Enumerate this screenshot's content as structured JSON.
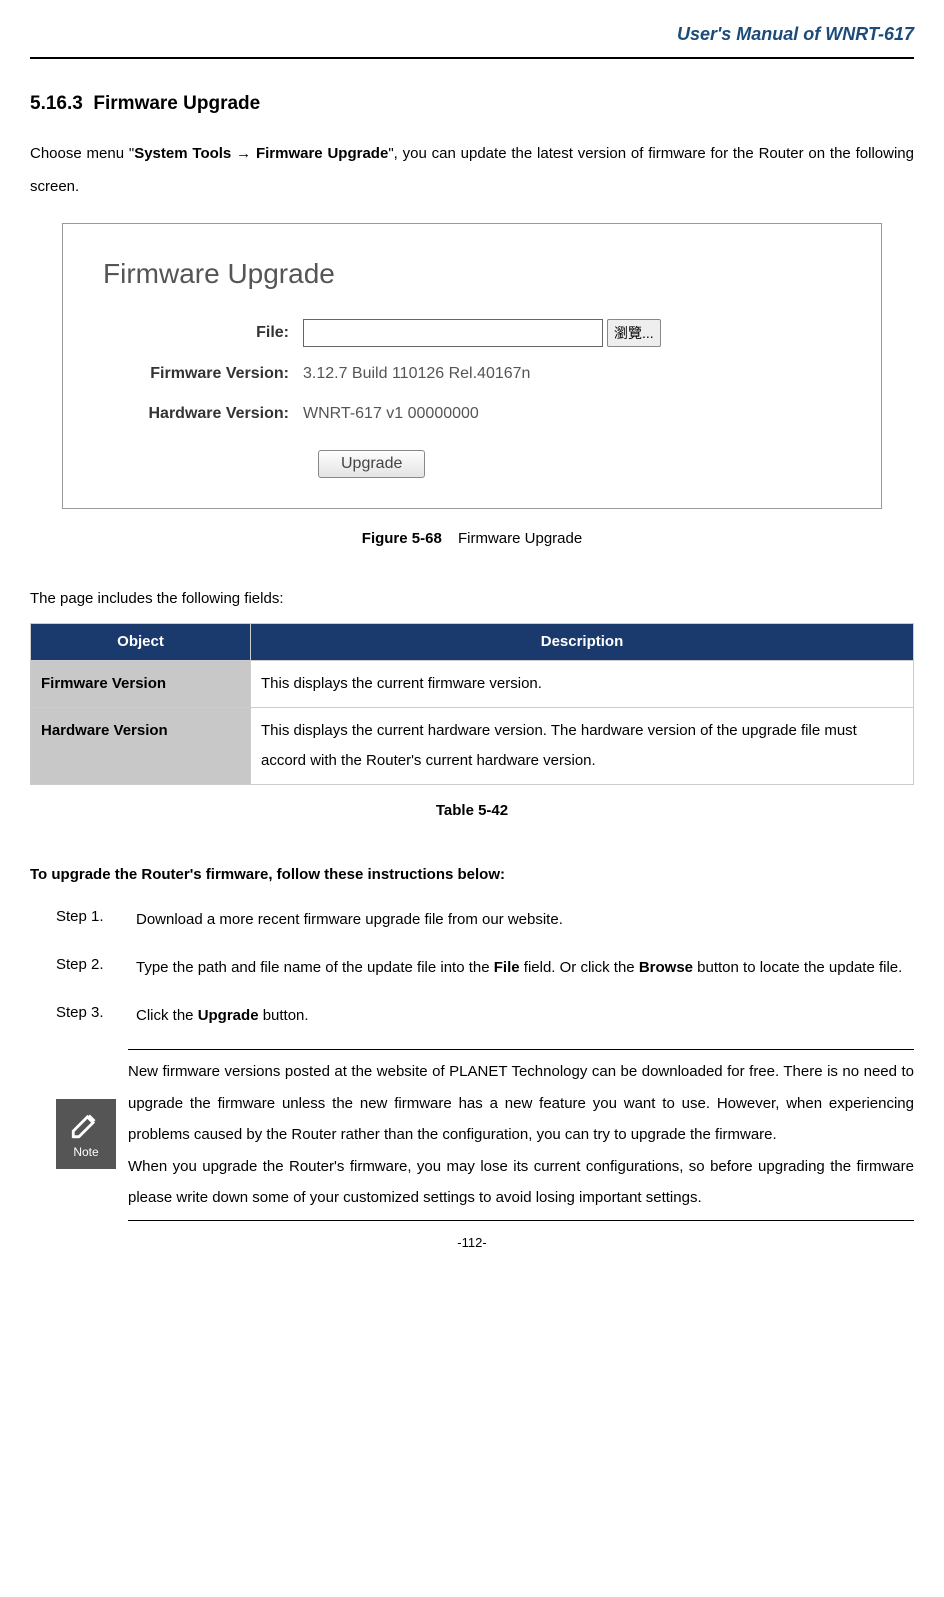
{
  "header": {
    "title": "User's Manual of WNRT-617"
  },
  "section": {
    "number": "5.16.3",
    "title": "Firmware Upgrade"
  },
  "intro": {
    "prefix": "Choose menu \"",
    "menu1": "System Tools",
    "arrow": " → ",
    "menu2": "Firmware Upgrade",
    "suffix": "\", you can update the latest version of firmware for the Router on the following screen."
  },
  "screenshot": {
    "panel_title": "Firmware Upgrade",
    "file_label": "File:",
    "browse_btn": "瀏覽...",
    "fw_label": "Firmware Version:",
    "fw_value": "3.12.7 Build 110126 Rel.40167n",
    "hw_label": "Hardware Version:",
    "hw_value": "WNRT-617 v1 00000000",
    "upgrade_btn": "Upgrade"
  },
  "figure": {
    "num": "Figure 5-68",
    "caption": "Firmware Upgrade"
  },
  "fields_intro": "The page includes the following fields:",
  "table": {
    "head_object": "Object",
    "head_desc": "Description",
    "rows": [
      {
        "object": "Firmware Version",
        "desc": "This displays the current firmware version."
      },
      {
        "object": "Hardware Version",
        "desc": "This displays the current hardware version. The hardware version of the upgrade file must accord with the Router's current hardware version."
      }
    ],
    "caption": "Table 5-42"
  },
  "instructions": {
    "heading": "To upgrade the Router's firmware, follow these instructions below:",
    "steps": [
      {
        "label": "Step 1.",
        "text_plain": "Download a more recent firmware upgrade file from our website."
      },
      {
        "label": "Step 2.",
        "text_pre": "Type the path and file name of the update file into the ",
        "bold1": "File",
        "text_mid": " field. Or click the ",
        "bold2": "Browse",
        "text_post": " button to locate the update file."
      },
      {
        "label": "Step 3.",
        "text_pre": "Click the ",
        "bold1": "Upgrade",
        "text_post": " button."
      }
    ]
  },
  "note": {
    "icon_label": "Note",
    "para1": "New firmware versions posted at the website of PLANET Technology can be downloaded for free. There is no need to upgrade the firmware unless the new firmware has a new feature you want to use. However, when experiencing problems caused by the Router rather than the configuration, you can try to upgrade the firmware.",
    "para2": "When you upgrade the Router's firmware, you may lose its current configurations, so before upgrading the firmware please write down some of your customized settings to avoid losing important settings."
  },
  "page_number": "-112-"
}
